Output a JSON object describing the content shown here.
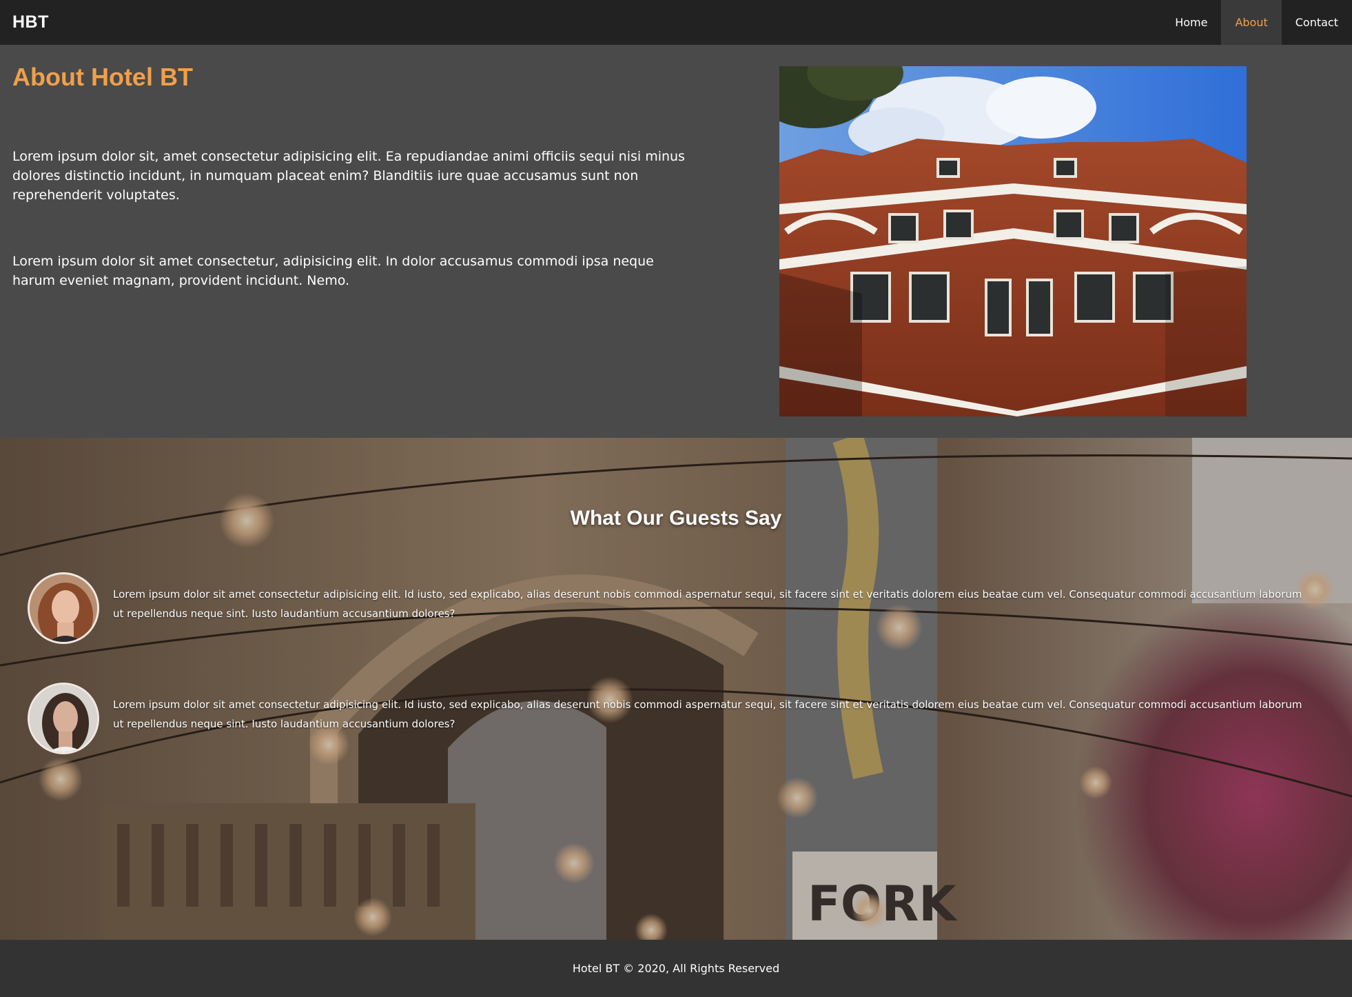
{
  "nav": {
    "brand": "HBT",
    "links": [
      {
        "label": "Home",
        "active": false
      },
      {
        "label": "About",
        "active": true
      },
      {
        "label": "Contact",
        "active": false
      }
    ]
  },
  "about": {
    "title": "About Hotel BT",
    "paragraphs": [
      "Lorem ipsum dolor sit, amet consectetur adipisicing elit. Ea repudiandae animi officiis sequi nisi minus dolores distinctio incidunt, in numquam placeat enim? Blanditiis iure quae accusamus sunt non reprehenderit voluptates.",
      "Lorem ipsum dolor sit amet consectetur, adipisicing elit. In dolor accusamus commodi ipsa neque harum eveniet magnam, provident incidunt. Nemo."
    ]
  },
  "testimonials": {
    "title": "What Our Guests Say",
    "reviews": [
      {
        "text": "Lorem ipsum dolor sit amet consectetur adipisicing elit. Id iusto, sed explicabo, alias deserunt nobis commodi aspernatur sequi, sit facere sint et veritatis dolorem eius beatae cum vel. Consequatur commodi accusantium laborum ut repellendus neque sint. Iusto laudantium accusantium dolores?"
      },
      {
        "text": "Lorem ipsum dolor sit amet consectetur adipisicing elit. Id iusto, sed explicabo, alias deserunt nobis commodi aspernatur sequi, sit facere sint et veritatis dolorem eius beatae cum vel. Consequatur commodi accusantium laborum ut repellendus neque sint. Iusto laudantium accusantium dolores?"
      }
    ]
  },
  "footer": {
    "text": "Hotel BT © 2020, All Rights Reserved"
  },
  "colors": {
    "accent": "#f0a04b",
    "nav_bg": "#222222",
    "section_bg": "#4a4a4a",
    "footer_bg": "#333333"
  }
}
